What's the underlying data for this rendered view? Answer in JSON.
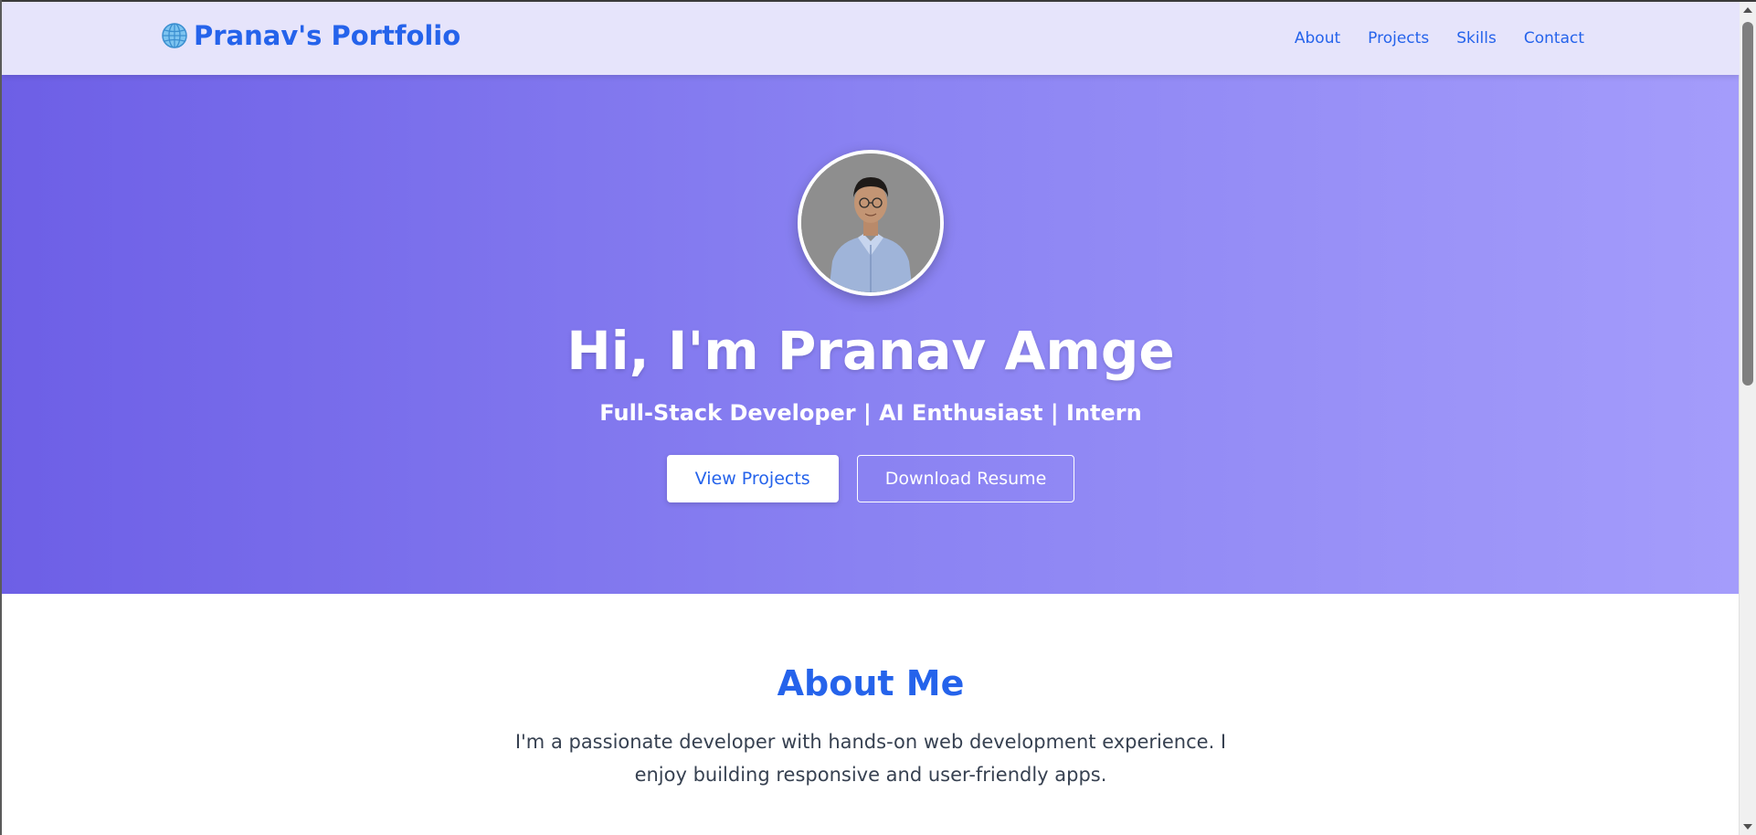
{
  "navbar": {
    "brand_label": "Pranav's Portfolio",
    "brand_icon": "globe-icon",
    "links": [
      {
        "label": "About"
      },
      {
        "label": "Projects"
      },
      {
        "label": "Skills"
      },
      {
        "label": "Contact"
      }
    ]
  },
  "hero": {
    "title": "Hi, I'm Pranav Amge",
    "subtitle": "Full-Stack Developer | AI Enthusiast | Intern",
    "primary_button": "View Projects",
    "secondary_button": "Download Resume",
    "avatar_icon": "profile-photo"
  },
  "about": {
    "title": "About Me",
    "text": "I'm a passionate developer with hands-on web development experience. I enjoy building responsive and user-friendly apps."
  },
  "colors": {
    "accent": "#2563eb",
    "navbar_bg": "#e6e4fb",
    "hero_gradient_start": "#6d5fe6",
    "hero_gradient_end": "#a49cfb",
    "body_text": "#374151"
  }
}
